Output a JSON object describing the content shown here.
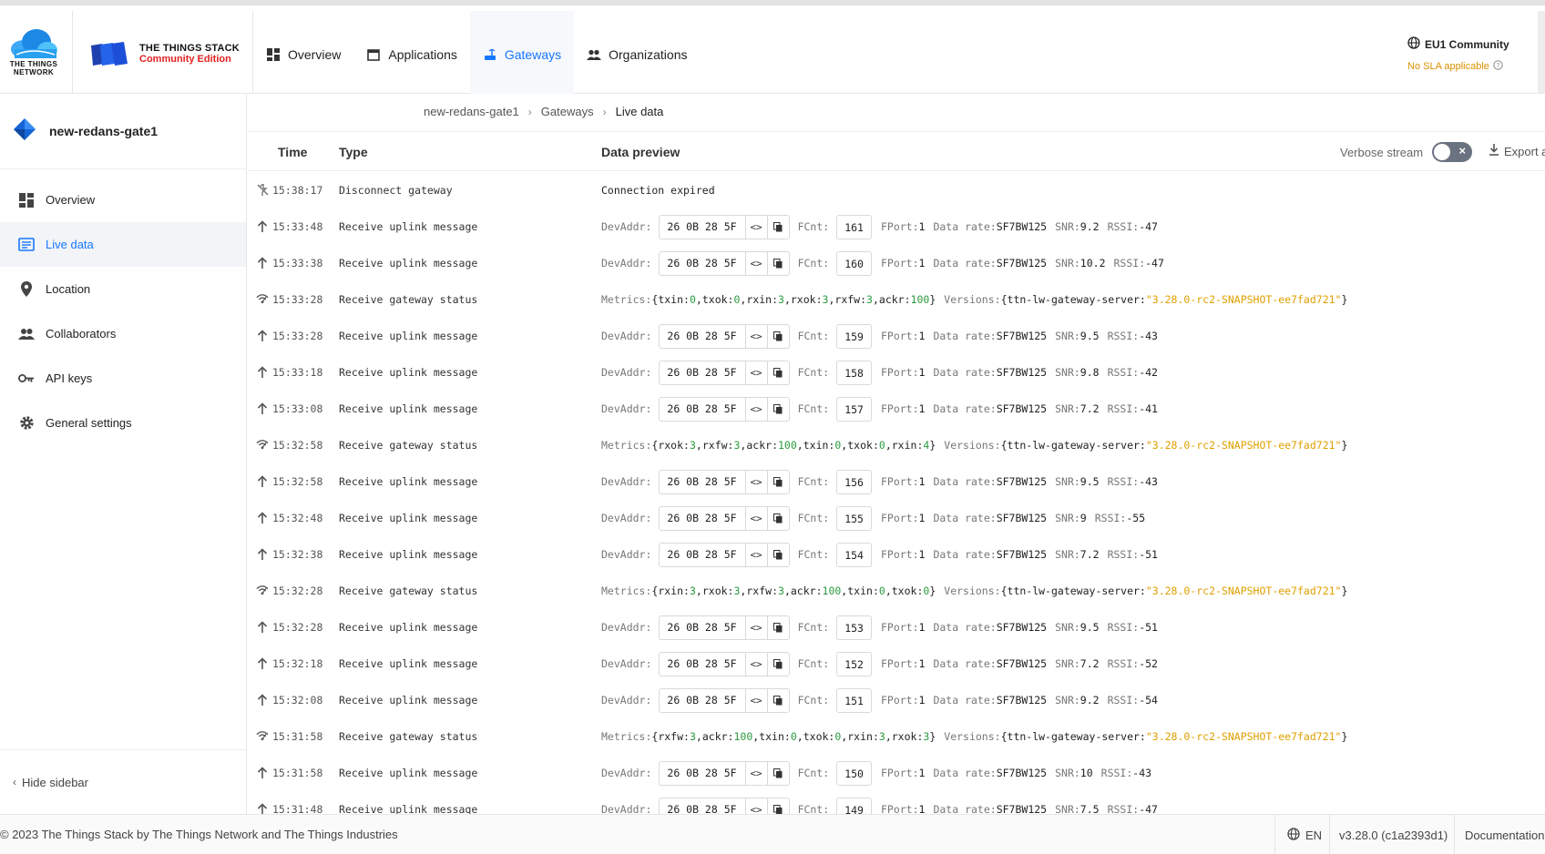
{
  "colors": {
    "accent": "#1677ff",
    "brand_red": "#e02020",
    "warning": "#d99000",
    "number": "#2b9a3e",
    "string": "#e0a000"
  },
  "logo": {
    "ttn_text": "THE THINGS NETWORK",
    "tts_title": "THE THINGS STACK",
    "tts_edition": "Community Edition"
  },
  "nav": [
    {
      "label": "Overview",
      "icon": "grid-icon"
    },
    {
      "label": "Applications",
      "icon": "window-icon"
    },
    {
      "label": "Gateways",
      "icon": "gateway-icon"
    },
    {
      "label": "Organizations",
      "icon": "people-icon"
    }
  ],
  "region": {
    "name": "EU1 Community",
    "sla": "No SLA applicable"
  },
  "sidebar": {
    "gateway_name": "new-redans-gate1",
    "items": [
      {
        "label": "Overview",
        "icon": "grid-icon"
      },
      {
        "label": "Live data",
        "icon": "list-icon"
      },
      {
        "label": "Location",
        "icon": "pin-icon"
      },
      {
        "label": "Collaborators",
        "icon": "people-icon"
      },
      {
        "label": "API keys",
        "icon": "key-icon"
      },
      {
        "label": "General settings",
        "icon": "gear-icon"
      }
    ],
    "hide_label": "Hide sidebar"
  },
  "breadcrumb": [
    "new-redans-gate1",
    "Gateways",
    "Live data"
  ],
  "table": {
    "headers": {
      "time": "Time",
      "type": "Type",
      "preview": "Data preview"
    },
    "verbose_label": "Verbose stream",
    "export_label": "Export as JSON"
  },
  "labels": {
    "devaddr": "DevAddr:",
    "fcnt": "FCnt:",
    "fport": "FPort:",
    "datarate": "Data rate:",
    "snr": "SNR:",
    "rssi": "RSSI:",
    "metrics": "Metrics:",
    "versions": "Versions:",
    "server_key": "ttn-lw-gateway-server:",
    "brace_open": "{",
    "brace_close": "}",
    "comma": ",",
    "copy_symbol": "<>"
  },
  "rows": [
    {
      "kind": "disconnect",
      "time": "15:38:17",
      "type": "Disconnect gateway",
      "message": "Connection expired"
    },
    {
      "kind": "uplink",
      "time": "15:33:48",
      "type": "Receive uplink message",
      "devaddr": "26 0B 28 5F",
      "fcnt": "161",
      "fport": "1",
      "datarate": "SF7BW125",
      "snr": "9.2",
      "rssi": "-47"
    },
    {
      "kind": "uplink",
      "time": "15:33:38",
      "type": "Receive uplink message",
      "devaddr": "26 0B 28 5F",
      "fcnt": "160",
      "fport": "1",
      "datarate": "SF7BW125",
      "snr": "10.2",
      "rssi": "-47"
    },
    {
      "kind": "status",
      "time": "15:33:28",
      "type": "Receive gateway status",
      "metrics": [
        [
          "txin",
          "0"
        ],
        [
          "txok",
          "0"
        ],
        [
          "rxin",
          "3"
        ],
        [
          "rxok",
          "3"
        ],
        [
          "rxfw",
          "3"
        ],
        [
          "ackr",
          "100"
        ]
      ],
      "version": "\"3.28.0-rc2-SNAPSHOT-ee7fad721\""
    },
    {
      "kind": "uplink",
      "time": "15:33:28",
      "type": "Receive uplink message",
      "devaddr": "26 0B 28 5F",
      "fcnt": "159",
      "fport": "1",
      "datarate": "SF7BW125",
      "snr": "9.5",
      "rssi": "-43"
    },
    {
      "kind": "uplink",
      "time": "15:33:18",
      "type": "Receive uplink message",
      "devaddr": "26 0B 28 5F",
      "fcnt": "158",
      "fport": "1",
      "datarate": "SF7BW125",
      "snr": "9.8",
      "rssi": "-42"
    },
    {
      "kind": "uplink",
      "time": "15:33:08",
      "type": "Receive uplink message",
      "devaddr": "26 0B 28 5F",
      "fcnt": "157",
      "fport": "1",
      "datarate": "SF7BW125",
      "snr": "7.2",
      "rssi": "-41"
    },
    {
      "kind": "status",
      "time": "15:32:58",
      "type": "Receive gateway status",
      "metrics": [
        [
          "rxok",
          "3"
        ],
        [
          "rxfw",
          "3"
        ],
        [
          "ackr",
          "100"
        ],
        [
          "txin",
          "0"
        ],
        [
          "txok",
          "0"
        ],
        [
          "rxin",
          "4"
        ]
      ],
      "version": "\"3.28.0-rc2-SNAPSHOT-ee7fad721\""
    },
    {
      "kind": "uplink",
      "time": "15:32:58",
      "type": "Receive uplink message",
      "devaddr": "26 0B 28 5F",
      "fcnt": "156",
      "fport": "1",
      "datarate": "SF7BW125",
      "snr": "9.5",
      "rssi": "-43"
    },
    {
      "kind": "uplink",
      "time": "15:32:48",
      "type": "Receive uplink message",
      "devaddr": "26 0B 28 5F",
      "fcnt": "155",
      "fport": "1",
      "datarate": "SF7BW125",
      "snr": "9",
      "rssi": "-55"
    },
    {
      "kind": "uplink",
      "time": "15:32:38",
      "type": "Receive uplink message",
      "devaddr": "26 0B 28 5F",
      "fcnt": "154",
      "fport": "1",
      "datarate": "SF7BW125",
      "snr": "7.2",
      "rssi": "-51"
    },
    {
      "kind": "status",
      "time": "15:32:28",
      "type": "Receive gateway status",
      "metrics": [
        [
          "rxin",
          "3"
        ],
        [
          "rxok",
          "3"
        ],
        [
          "rxfw",
          "3"
        ],
        [
          "ackr",
          "100"
        ],
        [
          "txin",
          "0"
        ],
        [
          "txok",
          "0"
        ]
      ],
      "version": "\"3.28.0-rc2-SNAPSHOT-ee7fad721\""
    },
    {
      "kind": "uplink",
      "time": "15:32:28",
      "type": "Receive uplink message",
      "devaddr": "26 0B 28 5F",
      "fcnt": "153",
      "fport": "1",
      "datarate": "SF7BW125",
      "snr": "9.5",
      "rssi": "-51"
    },
    {
      "kind": "uplink",
      "time": "15:32:18",
      "type": "Receive uplink message",
      "devaddr": "26 0B 28 5F",
      "fcnt": "152",
      "fport": "1",
      "datarate": "SF7BW125",
      "snr": "7.2",
      "rssi": "-52"
    },
    {
      "kind": "uplink",
      "time": "15:32:08",
      "type": "Receive uplink message",
      "devaddr": "26 0B 28 5F",
      "fcnt": "151",
      "fport": "1",
      "datarate": "SF7BW125",
      "snr": "9.2",
      "rssi": "-54"
    },
    {
      "kind": "status",
      "time": "15:31:58",
      "type": "Receive gateway status",
      "metrics": [
        [
          "rxfw",
          "3"
        ],
        [
          "ackr",
          "100"
        ],
        [
          "txin",
          "0"
        ],
        [
          "txok",
          "0"
        ],
        [
          "rxin",
          "3"
        ],
        [
          "rxok",
          "3"
        ]
      ],
      "version": "\"3.28.0-rc2-SNAPSHOT-ee7fad721\""
    },
    {
      "kind": "uplink",
      "time": "15:31:58",
      "type": "Receive uplink message",
      "devaddr": "26 0B 28 5F",
      "fcnt": "150",
      "fport": "1",
      "datarate": "SF7BW125",
      "snr": "10",
      "rssi": "-43"
    },
    {
      "kind": "uplink",
      "time": "15:31:48",
      "type": "Receive uplink message",
      "devaddr": "26 0B 28 5F",
      "fcnt": "149",
      "fport": "1",
      "datarate": "SF7BW125",
      "snr": "7.5",
      "rssi": "-47"
    }
  ],
  "footer": {
    "copyright": "© 2023 The Things Stack by The Things Network and The Things Industries",
    "language": "EN",
    "version": "v3.28.0 (c1a2393d1)",
    "docs": "Documentation"
  }
}
